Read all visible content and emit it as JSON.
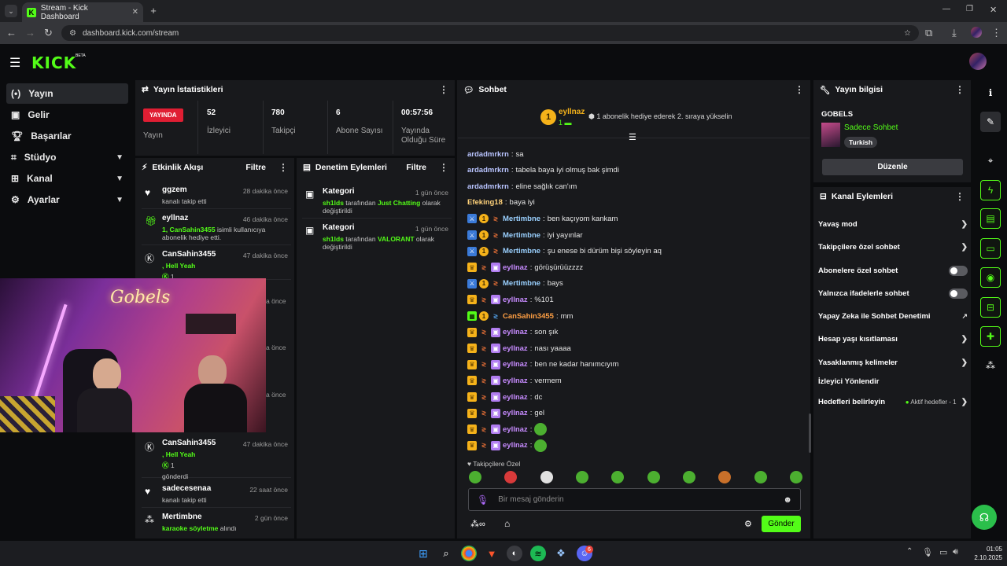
{
  "browser": {
    "tab_title": "Stream - Kick Dashboard",
    "url": "dashboard.kick.com/stream"
  },
  "app": {
    "logo": "KICK",
    "beta": "BETA"
  },
  "sidebar": {
    "items": [
      {
        "label": "Yayın",
        "icon": "broadcast-icon",
        "active": true
      },
      {
        "label": "Gelir",
        "icon": "revenue-icon"
      },
      {
        "label": "Başarılar",
        "icon": "trophy-icon"
      },
      {
        "label": "Stüdyo",
        "icon": "studio-icon",
        "expandable": true
      },
      {
        "label": "Kanal",
        "icon": "channel-icon",
        "expandable": true
      },
      {
        "label": "Ayarlar",
        "icon": "settings-icon",
        "expandable": true
      }
    ]
  },
  "stats": {
    "title": "Yayın İstatistikleri",
    "live_badge": "YAYINDA",
    "live_label": "Yayın",
    "cells": [
      {
        "value": "52",
        "label": "İzleyici"
      },
      {
        "value": "780",
        "label": "Takipçi"
      },
      {
        "value": "6",
        "label": "Abone Sayısı"
      },
      {
        "value": "00:57:56",
        "label": "Yayında Olduğu Süre"
      }
    ]
  },
  "activity": {
    "title": "Etkinlik Akışı",
    "filter": "Filtre",
    "events": [
      {
        "name": "ggzem",
        "time": "28 dakika önce",
        "desc": "kanalı takip etti"
      },
      {
        "name": "eyllnaz",
        "time": "46 dakika önce",
        "desc_pre": "1, ",
        "desc_hl": "CanSahin3455",
        "desc_post": " isimli kullanıcıya abonelik hediye etti."
      },
      {
        "name": "CanSahin3455",
        "time": "47 dakika önce",
        "hl": ", Hell Yeah",
        "amount": "1"
      },
      {
        "name": "CanSahin3455",
        "time": "47 dakika önce",
        "hl": ", Hell Yeah",
        "amount": "1",
        "desc": "gönderdi"
      },
      {
        "name": "sadecesenaa",
        "time": "22 saat önce",
        "desc": "kanalı takip etti"
      },
      {
        "name": "Mertimbne",
        "time": "2 gün önce",
        "desc_hl": "karaoke söyletme",
        "desc_post": " alındı"
      }
    ],
    "partial_times": [
      "a önce",
      "a önce",
      "a önce"
    ]
  },
  "moderation": {
    "title": "Denetim Eylemleri",
    "filter": "Filtre",
    "items": [
      {
        "title": "Kategori",
        "time": "1 gün önce",
        "user": "sh1lds",
        "mid": " tarafından ",
        "game": "Just Chatting",
        "tail": " olarak değiştirildi"
      },
      {
        "title": "Kategori",
        "time": "1 gün önce",
        "user": "sh1lds",
        "mid": " tarafından ",
        "game": "VALORANT",
        "tail": " olarak değiştirildi"
      }
    ]
  },
  "chat": {
    "title": "Sohbet",
    "pinned_user": "eyllnaz",
    "pinned_count": "1",
    "pinned_msg": "1 abonelik hediye ederek 2. sıraya yükselin",
    "messages": [
      {
        "user": "ardadmrkrn",
        "text": "sa",
        "color": "#b9c4ff"
      },
      {
        "user": "ardadmrkrn",
        "text": "tabela baya iyi olmuş bak şimdi",
        "color": "#b9c4ff"
      },
      {
        "user": "ardadmrkrn",
        "text": "eline sağlık can'ım",
        "color": "#b9c4ff"
      },
      {
        "user": "Efeking18",
        "text": "baya iyi",
        "color": "#ffd27a"
      },
      {
        "user": "Mertimbne",
        "text": "ben kaçıyom kankam",
        "color": "#9ad0ff",
        "badges": "mod"
      },
      {
        "user": "Mertimbne",
        "text": "iyi yayınlar",
        "color": "#9ad0ff",
        "badges": "mod"
      },
      {
        "user": "Mertimbne",
        "text": "şu enese bi dürüm bişi söyleyin aq",
        "color": "#9ad0ff",
        "badges": "mod"
      },
      {
        "user": "eyllnaz",
        "text": "görüşürüüzzzz",
        "color": "#c78bff",
        "badges": "vip"
      },
      {
        "user": "Mertimbne",
        "text": "bays",
        "color": "#9ad0ff",
        "badges": "mod"
      },
      {
        "user": "eyllnaz",
        "text": "%101",
        "color": "#c78bff",
        "badges": "vip"
      },
      {
        "user": "CanSahin3455",
        "text": "mm",
        "color": "#ff9f43",
        "badges": "og"
      },
      {
        "user": "eyllnaz",
        "text": "son şık",
        "color": "#c78bff",
        "badges": "vip"
      },
      {
        "user": "eyllnaz",
        "text": "nası yaaaa",
        "color": "#c78bff",
        "badges": "vip"
      },
      {
        "user": "eyllnaz",
        "text": "ben ne kadar hanımcıyım",
        "color": "#c78bff",
        "badges": "vip"
      },
      {
        "user": "eyllnaz",
        "text": "vermem",
        "color": "#c78bff",
        "badges": "vip"
      },
      {
        "user": "eyllnaz",
        "text": "dc",
        "color": "#c78bff",
        "badges": "vip"
      },
      {
        "user": "eyllnaz",
        "text": "gel",
        "color": "#c78bff",
        "badges": "vip"
      },
      {
        "user": "eyllnaz",
        "text": "",
        "color": "#c78bff",
        "badges": "vip",
        "emote": true
      },
      {
        "user": "eyllnaz",
        "text": "",
        "color": "#c78bff",
        "badges": "vip",
        "emote": true
      }
    ],
    "followers_only": "Takipçilere Özel",
    "input_placeholder": "Bir mesaj gönderin",
    "send": "Gönder"
  },
  "stream_info": {
    "title": "Yayın bilgisi",
    "stream_title": "GOBELS",
    "category": "Sadece Sohbet",
    "language": "Turkish",
    "edit": "Düzenle"
  },
  "channel_actions": {
    "title": "Kanal Eylemleri",
    "rows": [
      {
        "label": "Yavaş mod",
        "type": "chevron"
      },
      {
        "label": "Takipçilere özel sohbet",
        "type": "chevron"
      },
      {
        "label": "Abonelere özel sohbet",
        "type": "toggle"
      },
      {
        "label": "Yalnızca ifadelerle sohbet",
        "type": "toggle"
      },
      {
        "label": "Yapay Zeka ile Sohbet Denetimi",
        "type": "external"
      },
      {
        "label": "Hesap yaşı kısıtlaması",
        "type": "chevron"
      },
      {
        "label": "Yasaklanmış kelimeler",
        "type": "chevron"
      },
      {
        "label": "İzleyici Yönlendir",
        "type": "none"
      },
      {
        "label": "Hedefleri belirleyin",
        "type": "chevron",
        "extra": "Aktif hedefler - 1"
      }
    ]
  },
  "taskbar": {
    "time": "01:05",
    "date": "2.10.2025",
    "discord_badge": "6"
  },
  "colors": {
    "accent": "#53fc18",
    "live": "#e01e33",
    "panel": "#18191c",
    "background": "#0b0c0e"
  }
}
